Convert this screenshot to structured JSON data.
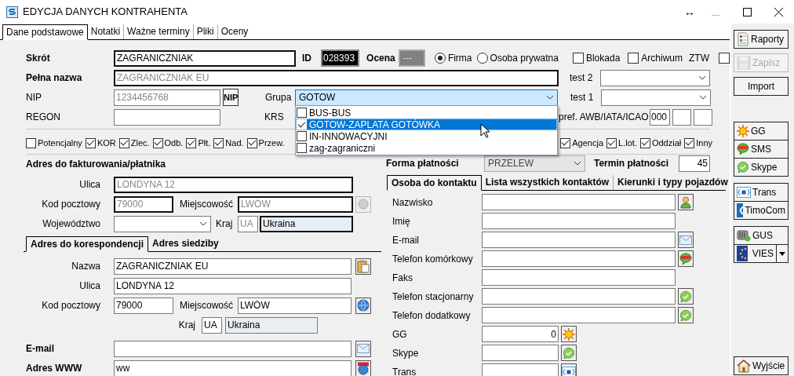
{
  "window": {
    "title": "EDYCJA DANYCH KONTRAHENTA",
    "resize_glyph": "↔"
  },
  "tabs": [
    {
      "label": "Dane podstawowe",
      "selected": true
    },
    {
      "label": "Notatki",
      "selected": false
    },
    {
      "label": "Ważne terminy",
      "selected": false
    },
    {
      "label": "Pliki",
      "selected": false
    },
    {
      "label": "Oceny",
      "selected": false
    }
  ],
  "header": {
    "skrot": {
      "label": "Skrót",
      "value": "ZAGRANICZNIAK"
    },
    "id": {
      "label": "ID",
      "value": "028393"
    },
    "ocena": {
      "label": "Ocena",
      "value": "---"
    },
    "entity_type": [
      {
        "label": "Firma",
        "selected": true
      },
      {
        "label": "Osoba prywatna",
        "selected": false
      }
    ],
    "flags": [
      {
        "label": "Blokada",
        "checked": false
      },
      {
        "label": "Archiwum",
        "checked": false
      }
    ],
    "ztw": {
      "label": "ZTW",
      "checked": false
    },
    "pelna_nazwa": {
      "label": "Pełna nazwa",
      "value": "ZAGRANICZNIAK EU"
    },
    "test2": {
      "label": "test 2"
    },
    "nip": {
      "label": "NIP",
      "value": "1234456768",
      "button": "NIP"
    },
    "grupa": {
      "label": "Grupa",
      "value": "GOTOW",
      "expanded": true,
      "options": [
        {
          "label": "BUS-BUS",
          "checked": false,
          "selected": false
        },
        {
          "label": "GOTOW-ZAPLATA GOTÓWKA",
          "checked": true,
          "selected": true
        },
        {
          "label": "IN-INNOWACYJNI",
          "checked": false,
          "selected": false
        },
        {
          "label": "zag-zagraniczni",
          "checked": false,
          "selected": false
        }
      ]
    },
    "test1": {
      "label": "test 1"
    },
    "regon": {
      "label": "REGON"
    },
    "krs": {
      "label": "KRS"
    },
    "pref": {
      "label": "pref. AWB/IATA/ICAO",
      "value": "000"
    }
  },
  "roles_left": [
    {
      "label": "Potencjalny",
      "checked": false
    },
    {
      "label": "KOR",
      "checked": true
    },
    {
      "label": "Zlec.",
      "checked": true
    },
    {
      "label": "Odb.",
      "checked": true
    },
    {
      "label": "Płt.",
      "checked": true
    },
    {
      "label": "Nad.",
      "checked": true
    },
    {
      "label": "Przew.",
      "checked": true
    }
  ],
  "roles_right": [
    {
      "label": "Agencja",
      "checked": true
    },
    {
      "label": "L.lot.",
      "checked": true
    },
    {
      "label": "Oddział",
      "checked": true
    },
    {
      "label": "Inny",
      "checked": true
    }
  ],
  "billing": {
    "title": "Adres do fakturowania/płatnika",
    "ulica": {
      "label": "Ulica",
      "value": "LONDYNA 12"
    },
    "kod": {
      "label": "Kod pocztowy",
      "value": "79000"
    },
    "miejscowosc": {
      "label": "Miejscowość",
      "value": "LWÓW"
    },
    "wojewodztwo": {
      "label": "Województwo"
    },
    "kraj": {
      "label": "Kraj",
      "code": "UA",
      "name": "Ukraina"
    }
  },
  "address_tabs": [
    {
      "label": "Adres do korespondencji",
      "selected": true
    },
    {
      "label": "Adres siedziby",
      "selected": false
    }
  ],
  "correspondence": {
    "nazwa": {
      "label": "Nazwa",
      "value": "ZAGRANICZNIAK EU"
    },
    "ulica": {
      "label": "Ulica",
      "value": "LONDYNA 12"
    },
    "kod": {
      "label": "Kod pocztowy",
      "value": "79000"
    },
    "miejscowosc": {
      "label": "Miejscowość",
      "value": "LWÓW"
    },
    "kraj": {
      "label": "Kraj",
      "code": "UA",
      "name": "Ukraina"
    }
  },
  "email": {
    "label": "E-mail"
  },
  "www": {
    "label": "Adres WWW",
    "value": "ww"
  },
  "payment": {
    "label": "Forma płatności",
    "value": "PRZELEW"
  },
  "term": {
    "label": "Termin płatności",
    "value": "45"
  },
  "contact_tabs": [
    {
      "label": "Osoba do kontaktu",
      "selected": true
    },
    {
      "label": "Lista wszystkich kontaktów",
      "selected": false
    },
    {
      "label": "Kierunki i typy pojazdów",
      "selected": false
    }
  ],
  "contact_fields": [
    {
      "label": "Nazwisko",
      "kind": "person"
    },
    {
      "label": "Imię",
      "kind": "plain"
    },
    {
      "label": "E-mail",
      "kind": "mail"
    },
    {
      "label": "Telefon komórkowy",
      "kind": "sms"
    },
    {
      "label": "Faks",
      "kind": "plain"
    },
    {
      "label": "Telefon stacjonarny",
      "kind": "skype"
    },
    {
      "label": "Telefon dodatkowy",
      "kind": "skype"
    },
    {
      "label": "GG",
      "kind": "gg",
      "value": "0"
    },
    {
      "label": "Skype",
      "kind": "skype-short"
    },
    {
      "label": "Trans",
      "kind": "trans-short"
    }
  ],
  "sidebar": [
    {
      "buttons": [
        {
          "label": "Raporty",
          "kind": "report",
          "disabled": false
        },
        {
          "label": "Zapisz",
          "kind": "save",
          "disabled": true
        },
        {
          "label": "Import",
          "kind": "plain",
          "disabled": false
        }
      ]
    },
    {
      "buttons": [
        {
          "label": "GG",
          "kind": "gg",
          "disabled": false
        },
        {
          "label": "SMS",
          "kind": "sms",
          "disabled": false
        },
        {
          "label": "Skype",
          "kind": "skype",
          "disabled": false
        }
      ]
    },
    {
      "buttons": [
        {
          "label": "Trans",
          "kind": "trans",
          "disabled": false
        },
        {
          "label": "TimoCom",
          "kind": "timocom",
          "disabled": false
        }
      ]
    },
    {
      "buttons": [
        {
          "label": "GUS",
          "kind": "gus",
          "disabled": false
        },
        {
          "label": "VIES",
          "kind": "vies",
          "disabled": false
        }
      ]
    },
    {
      "buttons": [
        {
          "label": "Wyjście",
          "kind": "home",
          "disabled": false
        }
      ]
    }
  ]
}
